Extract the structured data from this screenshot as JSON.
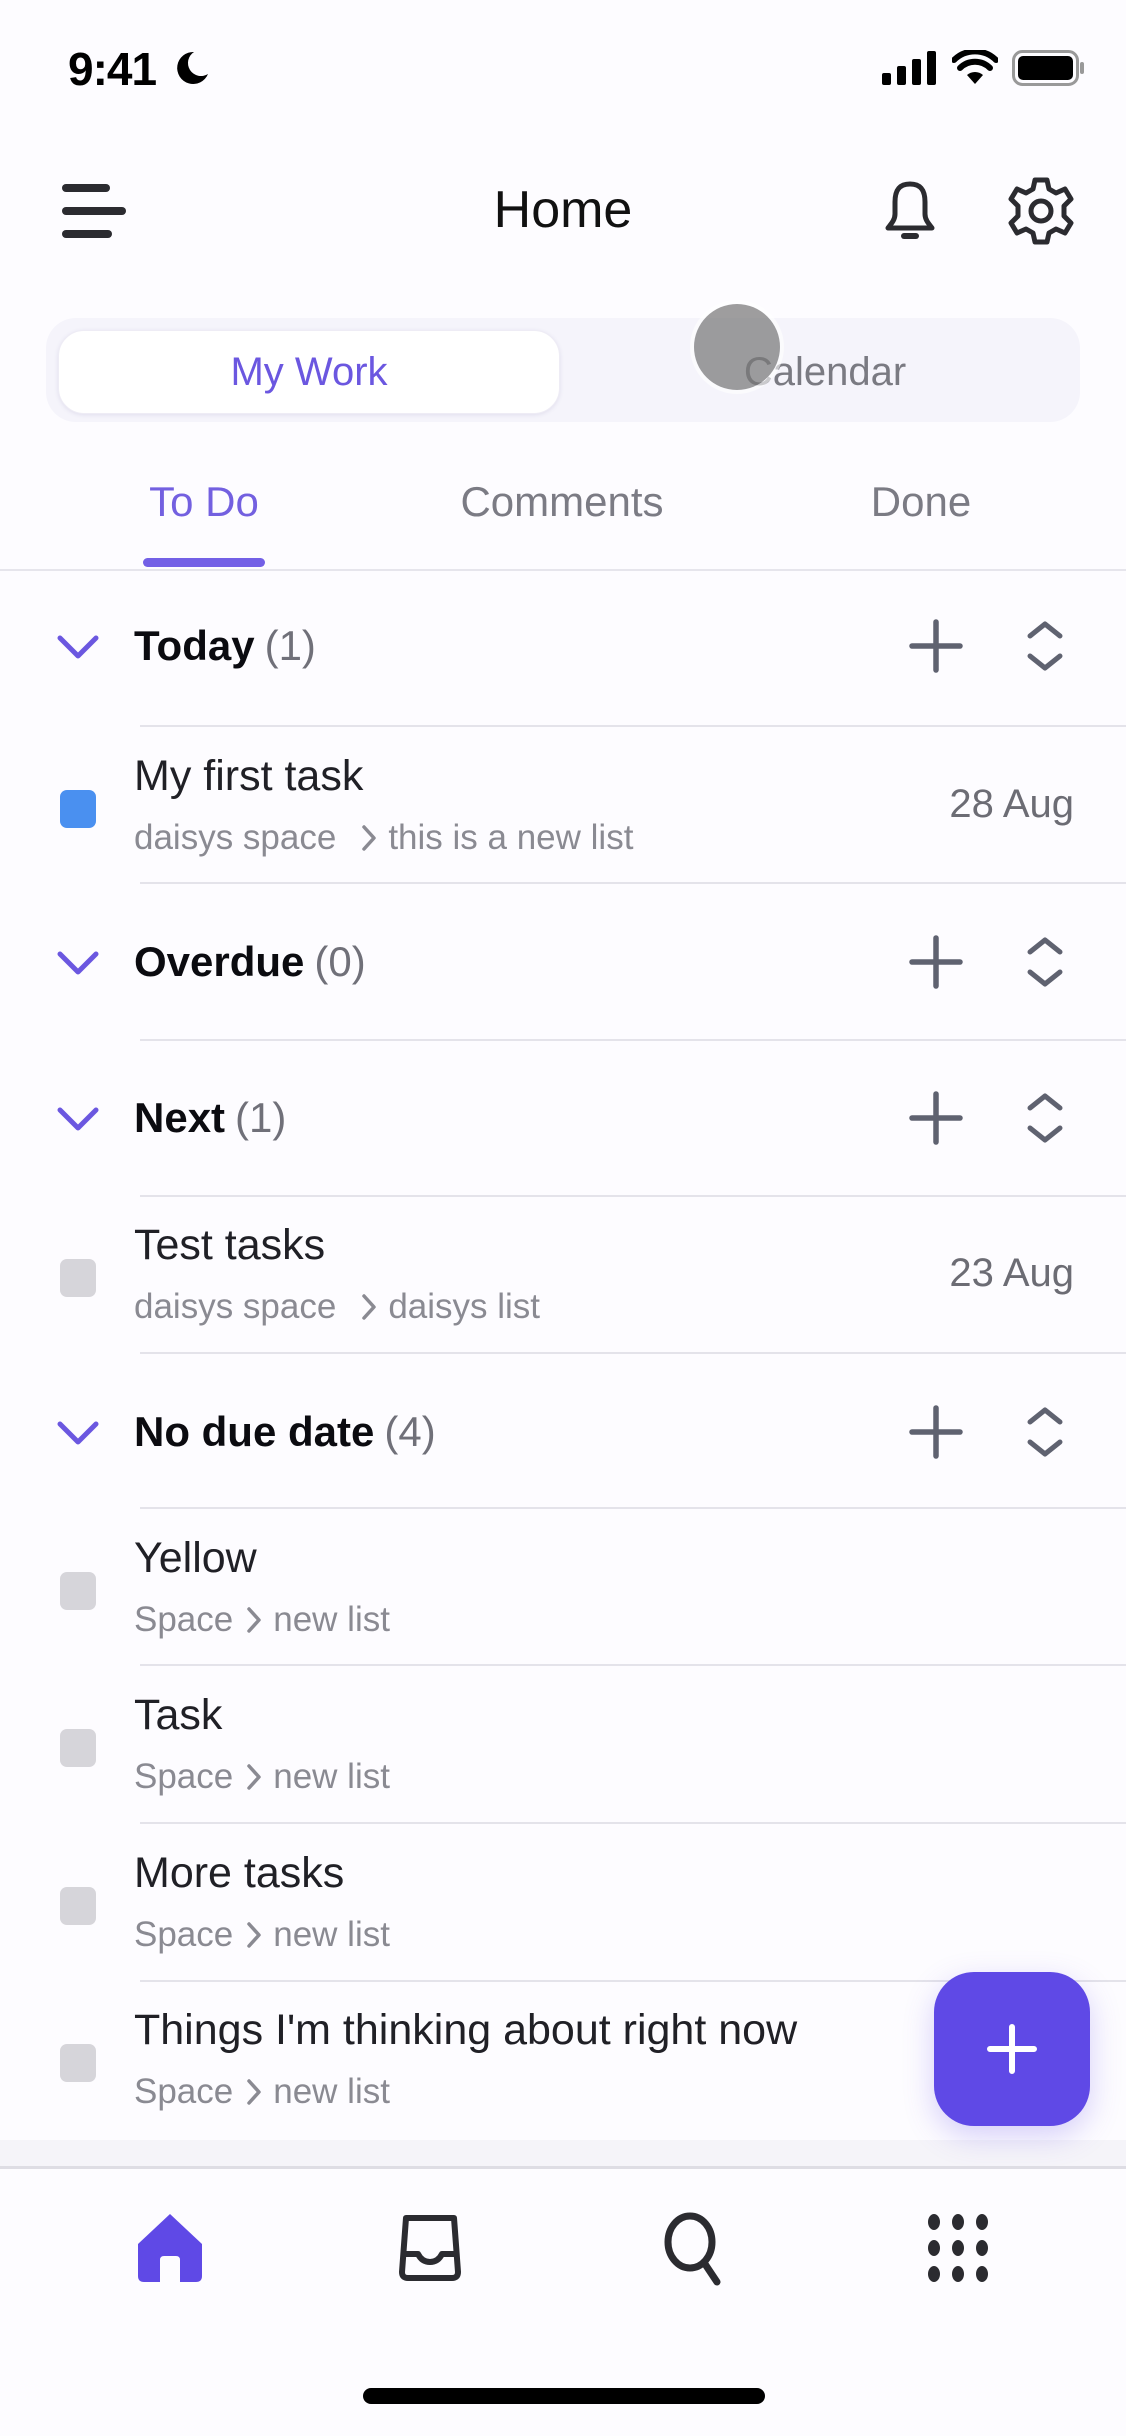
{
  "status_bar": {
    "time": "9:41",
    "focus_icon": "moon-icon",
    "icons": [
      "cellular-signal-icon",
      "wifi-icon",
      "battery-icon"
    ]
  },
  "header": {
    "title": "Home",
    "menu_icon": "hamburger-menu-icon",
    "notifications_icon": "bell-icon",
    "settings_icon": "gear-icon"
  },
  "segmented_control": {
    "options": [
      {
        "label": "My Work",
        "selected": true
      },
      {
        "label": "Calendar",
        "selected": false
      }
    ]
  },
  "tabs": [
    {
      "label": "To Do",
      "active": true
    },
    {
      "label": "Comments",
      "active": false
    },
    {
      "label": "Done",
      "active": false
    }
  ],
  "sections": [
    {
      "title": "Today",
      "count": "(1)",
      "tasks": [
        {
          "title": "My first task",
          "space": "daisys space",
          "list": "this is a new list",
          "date": "28 Aug",
          "status_color": "#4a90f0"
        }
      ]
    },
    {
      "title": "Overdue",
      "count": "(0)",
      "tasks": []
    },
    {
      "title": "Next",
      "count": "(1)",
      "tasks": [
        {
          "title": "Test tasks",
          "space": "daisys space",
          "list": "daisys list",
          "date": "23 Aug",
          "status_color": "#d6d5da"
        }
      ]
    },
    {
      "title": "No due date",
      "count": "(4)",
      "tasks": [
        {
          "title": "Yellow",
          "space": "Space",
          "list": "new list",
          "date": "",
          "status_color": "#d6d5da"
        },
        {
          "title": "Task",
          "space": "Space",
          "list": "new list",
          "date": "",
          "status_color": "#d6d5da"
        },
        {
          "title": "More tasks",
          "space": "Space",
          "list": "new list",
          "date": "",
          "status_color": "#d6d5da"
        },
        {
          "title": "Things I'm thinking about right now",
          "space": "Space",
          "list": "new list",
          "date": "",
          "status_color": "#d6d5da"
        }
      ]
    }
  ],
  "fab": {
    "icon": "plus-icon",
    "color": "#5f49e6"
  },
  "bottom_nav": [
    {
      "name": "home",
      "icon": "home-icon",
      "active": true
    },
    {
      "name": "inbox",
      "icon": "inbox-icon",
      "active": false
    },
    {
      "name": "search",
      "icon": "search-icon",
      "active": false
    },
    {
      "name": "apps",
      "icon": "grid-icon",
      "active": false
    }
  ],
  "colors": {
    "accent": "#6b57e0",
    "text_primary": "#202026",
    "text_secondary": "#8a8a92",
    "icon_gray": "#5f6270"
  }
}
